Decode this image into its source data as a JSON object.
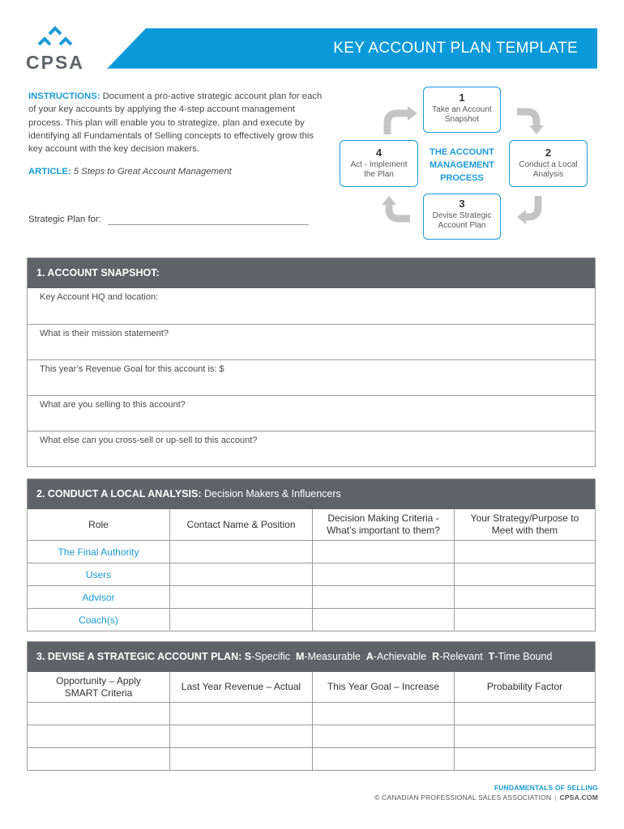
{
  "brand": {
    "logo_text": "CPSA",
    "accent_color": "#1a9ad6",
    "header_gray": "#5f6368"
  },
  "banner": {
    "title": "KEY ACCOUNT PLAN TEMPLATE"
  },
  "instructions": {
    "label": "INSTRUCTIONS:",
    "text": " Document a pro-active strategic account plan for each of your key accounts by applying the 4-step account management process. This plan will enable you to strategize, plan and execute by identifying all Fundamentals of Selling concepts to effectively grow this key account with the key decision makers."
  },
  "article": {
    "label": "ARTICLE:",
    "title": "5 Steps to Great Account Management"
  },
  "strategic_plan": {
    "label": "Strategic Plan for:",
    "value": ""
  },
  "process": {
    "title_lines": [
      "THE ACCOUNT",
      "MANAGEMENT",
      "PROCESS"
    ],
    "steps": [
      {
        "num": "1",
        "lines": [
          "Take an Account",
          "Snapshot"
        ]
      },
      {
        "num": "2",
        "lines": [
          "Conduct a Local",
          "Analysis"
        ]
      },
      {
        "num": "3",
        "lines": [
          "Devise Strategic",
          "Account Plan"
        ]
      },
      {
        "num": "4",
        "lines": [
          "Act - Implement",
          "the Plan"
        ]
      }
    ]
  },
  "section1": {
    "title": "1. ACCOUNT SNAPSHOT:",
    "fields": [
      "Key Account HQ and location:",
      "What is their mission statement?",
      "This year’s Revenue Goal for this account is: $",
      "What are you selling to this account?",
      "What else can you cross-sell or up-sell to this account?"
    ]
  },
  "section2": {
    "title_bold": "2. CONDUCT A LOCAL ANALYSIS:",
    "title_light": " Decision Makers & Influencers",
    "columns": [
      [
        "Role"
      ],
      [
        "Contact Name & Position"
      ],
      [
        "Decision Making Criteria -",
        "What’s important to them?"
      ],
      [
        "Your Strategy/Purpose to",
        "Meet with them"
      ]
    ],
    "roles": [
      "The Final Authority",
      "Users",
      "Advisor",
      "Coach(s)"
    ]
  },
  "section3": {
    "title_bold": "3. DEVISE A STRATEGIC ACCOUNT PLAN:",
    "smart": [
      {
        "letter": "S",
        "word": "-Specific"
      },
      {
        "letter": "M",
        "word": "-Measurable"
      },
      {
        "letter": "A",
        "word": "-Achievable"
      },
      {
        "letter": "R",
        "word": "-Relevant"
      },
      {
        "letter": "T",
        "word": "-Time Bound"
      }
    ],
    "columns": [
      [
        "Opportunity – Apply",
        "SMART Criteria"
      ],
      [
        "Last Year Revenue – Actual"
      ],
      [
        "This Year Goal – Increase"
      ],
      [
        "Probability Factor"
      ]
    ],
    "row_count": 3
  },
  "footer": {
    "tagline": "FUNDAMENTALS OF SELLING",
    "copyright": "© CANADIAN PROFESSIONAL SALES ASSOCIATION",
    "site": "CPSA.COM"
  }
}
